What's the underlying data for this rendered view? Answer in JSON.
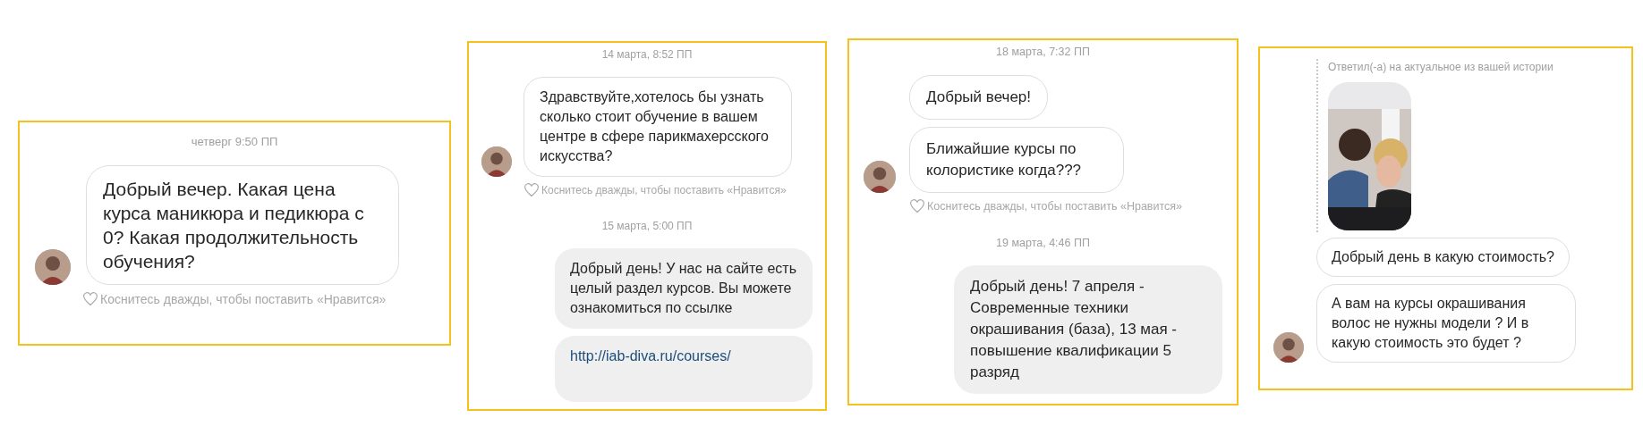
{
  "panels": [
    {
      "messages": [
        {
          "kind": "timestamp",
          "text": "четверг 9:50 ПП"
        },
        {
          "kind": "incoming",
          "text": "Добрый вечер. Какая цена курса маникюра и педикюра с 0? Какая продолжительность обучения?"
        },
        {
          "kind": "like_hint",
          "text": "Коснитесь дважды, чтобы поставить «Нравится»"
        }
      ]
    },
    {
      "messages": [
        {
          "kind": "timestamp",
          "text": "14 марта, 8:52 ПП"
        },
        {
          "kind": "incoming",
          "text": "Здравствуйте,хотелось бы узнать сколько стоит обучение в вашем центре в сфере парикмахерсского искусства?"
        },
        {
          "kind": "like_hint",
          "text": "Коснитесь дважды, чтобы поставить «Нравится»"
        },
        {
          "kind": "timestamp",
          "text": "15 марта, 5:00 ПП"
        },
        {
          "kind": "outgoing",
          "text": "Добрый день! У нас на сайте есть целый раздел  курсов. Вы можете ознакомиться по ссылке"
        },
        {
          "kind": "link",
          "text": "http://iab-diva.ru/courses/"
        }
      ]
    },
    {
      "messages": [
        {
          "kind": "timestamp",
          "text": "18 марта, 7:32 ПП"
        },
        {
          "kind": "incoming",
          "text": "Добрый вечер!"
        },
        {
          "kind": "incoming",
          "text": "Ближайшие курсы по колористике когда???"
        },
        {
          "kind": "like_hint",
          "text": "Коснитесь дважды, чтобы поставить «Нравится»"
        },
        {
          "kind": "timestamp",
          "text": "19 марта, 4:46 ПП"
        },
        {
          "kind": "outgoing",
          "text": "Добрый день! 7 апреля - Современные техники окрашивания (база), 13 мая - повышение квалификации 5 разряд"
        }
      ]
    },
    {
      "messages": [
        {
          "kind": "story_reply",
          "text": "Ответил(-а) на актуальное из вашей истории"
        },
        {
          "kind": "incoming",
          "text": "Добрый день в какую стоимость?"
        },
        {
          "kind": "incoming",
          "text": "А вам на курсы окрашивания волос не нужны модели ? И в какую стоимость это будет ?"
        }
      ]
    }
  ]
}
